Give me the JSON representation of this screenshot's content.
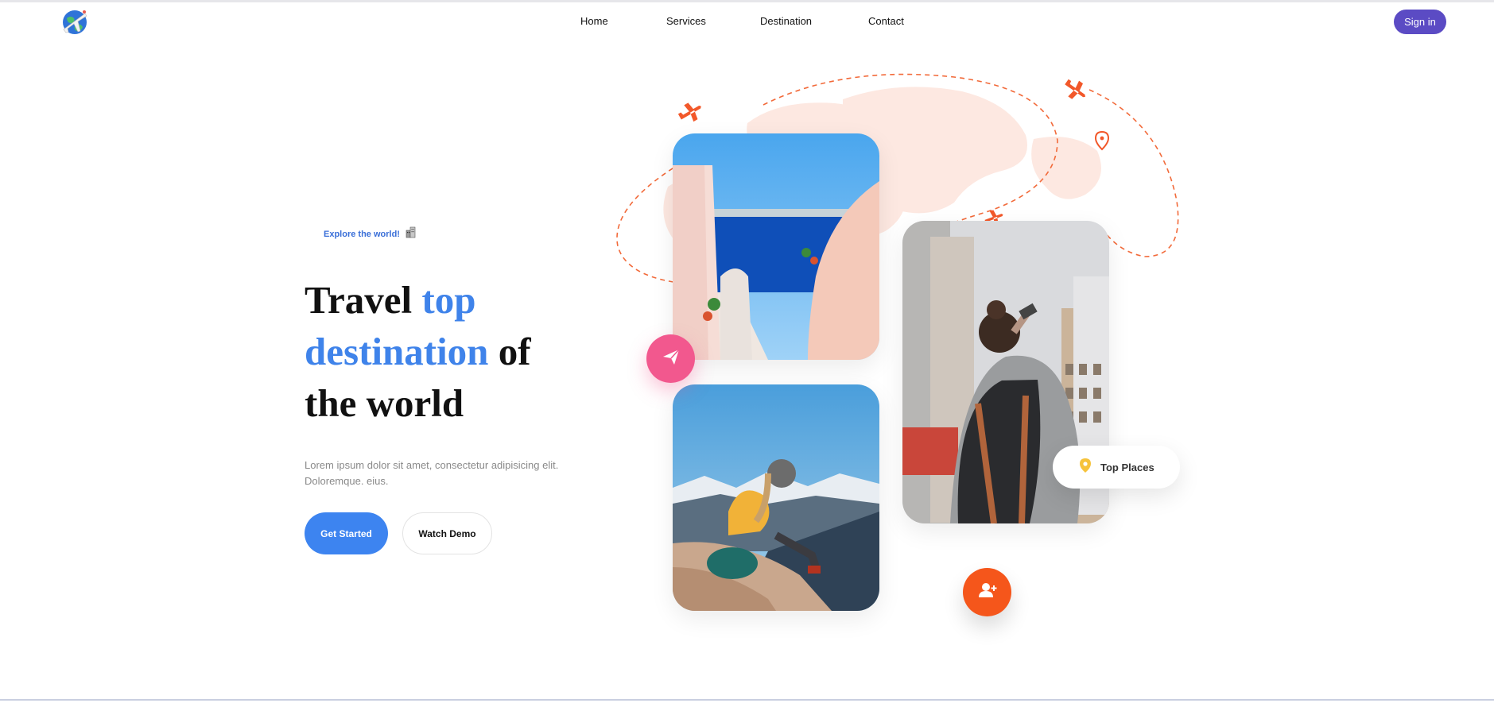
{
  "nav": {
    "logo_icon": "globe-airplane-icon",
    "links": [
      {
        "label": "Home"
      },
      {
        "label": "Services"
      },
      {
        "label": "Destination"
      },
      {
        "label": "Contact"
      }
    ],
    "signin_label": "Sign in"
  },
  "hero": {
    "tagline": "Explore the world!",
    "tagline_icon": "city-buildings-icon",
    "headline": {
      "part1": "Travel ",
      "accent1": "top",
      "accent2": "destination",
      "part2": " of",
      "part3": "the world"
    },
    "description_line1": "Lorem ipsum dolor sit amet, consectetur adipisicing elit.",
    "description_line2": "Doloremque. eius.",
    "primary_button": "Get Started",
    "secondary_button": "Watch Demo"
  },
  "gallery": {
    "badge_label": "Top Places",
    "badge_icon": "location-pin-icon",
    "send_icon": "paper-plane-icon",
    "add_user_icon": "add-user-icon"
  },
  "colors": {
    "accent_blue": "#3f83ea",
    "signin_purple": "#5b4bc4",
    "route_orange": "#f26a3a",
    "send_pink": "#f2588e",
    "user_orange": "#f5561b"
  }
}
